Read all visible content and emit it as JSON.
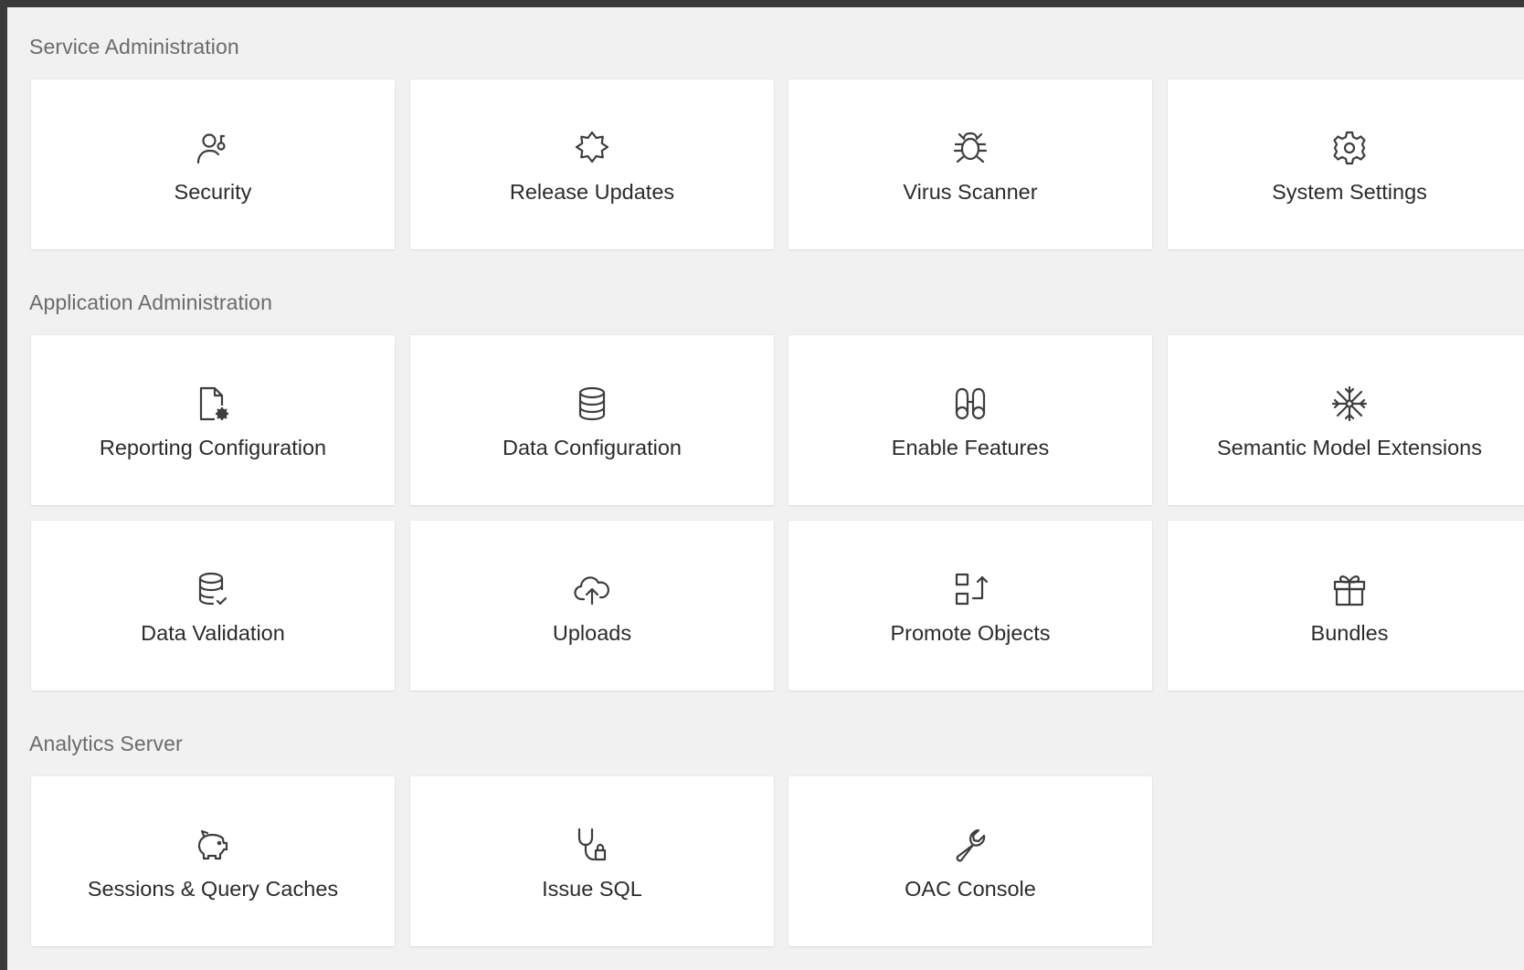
{
  "sections": [
    {
      "title": "Service Administration",
      "tiles": [
        {
          "label": "Security",
          "icon": "user-lock-icon"
        },
        {
          "label": "Release Updates",
          "icon": "badge-star-icon"
        },
        {
          "label": "Virus Scanner",
          "icon": "bug-icon"
        },
        {
          "label": "System Settings",
          "icon": "gear-icon"
        }
      ]
    },
    {
      "title": "Application Administration",
      "tiles": [
        {
          "label": "Reporting Configuration",
          "icon": "document-gear-icon"
        },
        {
          "label": "Data Configuration",
          "icon": "database-icon"
        },
        {
          "label": "Enable Features",
          "icon": "binoculars-icon"
        },
        {
          "label": "Semantic Model Extensions",
          "icon": "snowflake-icon"
        },
        {
          "label": "Data Validation",
          "icon": "database-check-icon"
        },
        {
          "label": "Uploads",
          "icon": "cloud-upload-icon"
        },
        {
          "label": "Promote Objects",
          "icon": "promote-objects-icon"
        },
        {
          "label": "Bundles",
          "icon": "gift-icon"
        }
      ]
    },
    {
      "title": "Analytics Server",
      "tiles": [
        {
          "label": "Sessions & Query Caches",
          "icon": "piggy-bank-icon"
        },
        {
          "label": "Issue SQL",
          "icon": "stethoscope-icon"
        },
        {
          "label": "OAC Console",
          "icon": "wrench-icon"
        }
      ]
    }
  ]
}
